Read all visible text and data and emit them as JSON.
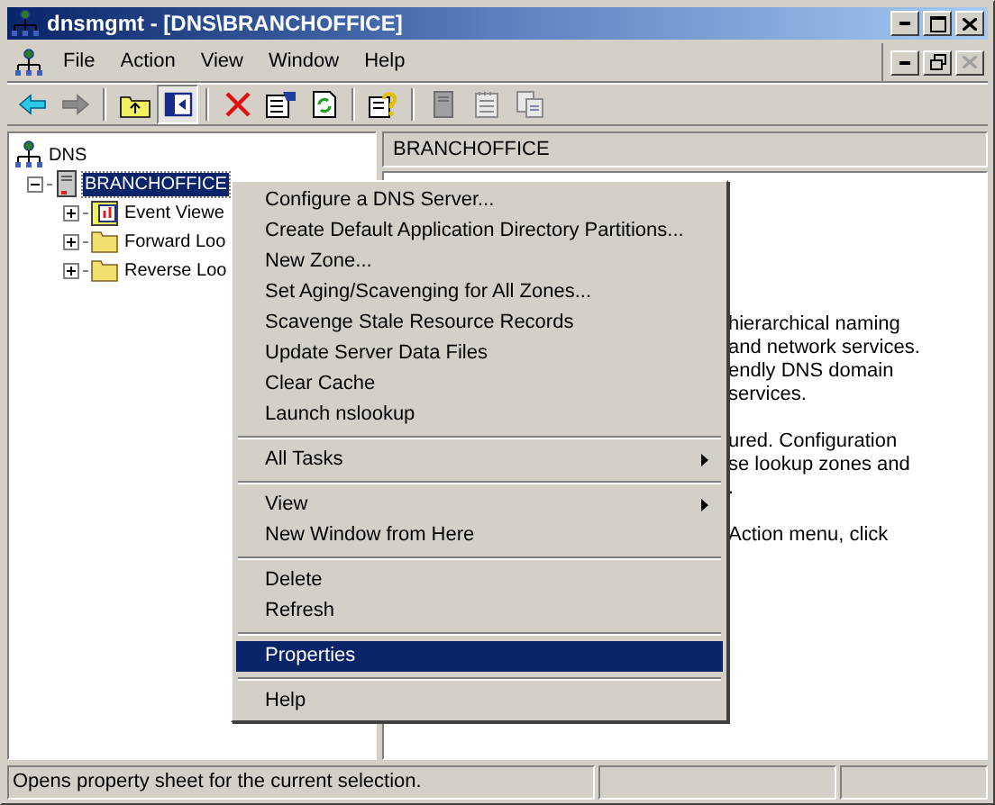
{
  "window": {
    "title": "dnsmgmt - [DNS\\BRANCHOFFICE]"
  },
  "menu_bar": [
    "File",
    "Action",
    "View",
    "Window",
    "Help"
  ],
  "toolbar": [
    {
      "kind": "back",
      "disabled": false,
      "pressed": false
    },
    {
      "kind": "forward",
      "disabled": true,
      "pressed": false
    },
    {
      "kind": "separator"
    },
    {
      "kind": "up",
      "disabled": false,
      "pressed": false
    },
    {
      "kind": "tree",
      "disabled": false,
      "pressed": true
    },
    {
      "kind": "separator"
    },
    {
      "kind": "delete",
      "disabled": false,
      "pressed": false
    },
    {
      "kind": "properties",
      "disabled": false,
      "pressed": false
    },
    {
      "kind": "refresh",
      "disabled": false,
      "pressed": false
    },
    {
      "kind": "separator"
    },
    {
      "kind": "help",
      "disabled": false,
      "pressed": false
    },
    {
      "kind": "separator"
    },
    {
      "kind": "server",
      "disabled": true,
      "pressed": false
    },
    {
      "kind": "notepad",
      "disabled": true,
      "pressed": false
    },
    {
      "kind": "copy",
      "disabled": true,
      "pressed": false
    }
  ],
  "tree": [
    {
      "label": "DNS",
      "kind": "dns",
      "expanded": true,
      "selected": false,
      "children": [
        {
          "label": "BRANCHOFFICE",
          "kind": "server",
          "expanded": true,
          "selected": true,
          "children": [
            {
              "label": "Event Viewe",
              "kind": "events",
              "expanded": false,
              "selected": false
            },
            {
              "label": "Forward Loo",
              "kind": "folder",
              "expanded": false,
              "selected": false
            },
            {
              "label": "Reverse Loo",
              "kind": "folder",
              "expanded": false,
              "selected": false
            }
          ]
        }
      ]
    }
  ],
  "right_pane": {
    "header": "BRANCHOFFICE",
    "paragraphs": [
      [
        "hierarchical naming",
        "and network services.",
        "endly DNS domain",
        "services."
      ],
      [
        "ured. Configuration",
        "se lookup zones and",
        "."
      ],
      [
        "Action menu, click"
      ]
    ]
  },
  "context_menu": [
    {
      "kind": "item",
      "label": "Configure a DNS Server...",
      "submenu": false,
      "selected": false
    },
    {
      "kind": "item",
      "label": "Create Default Application Directory Partitions...",
      "submenu": false,
      "selected": false
    },
    {
      "kind": "item",
      "label": "New Zone...",
      "submenu": false,
      "selected": false
    },
    {
      "kind": "item",
      "label": "Set Aging/Scavenging for All Zones...",
      "submenu": false,
      "selected": false
    },
    {
      "kind": "item",
      "label": "Scavenge Stale Resource Records",
      "submenu": false,
      "selected": false
    },
    {
      "kind": "item",
      "label": "Update Server Data Files",
      "submenu": false,
      "selected": false
    },
    {
      "kind": "item",
      "label": "Clear Cache",
      "submenu": false,
      "selected": false
    },
    {
      "kind": "item",
      "label": "Launch nslookup",
      "submenu": false,
      "selected": false
    },
    {
      "kind": "separator"
    },
    {
      "kind": "item",
      "label": "All Tasks",
      "submenu": true,
      "selected": false
    },
    {
      "kind": "separator"
    },
    {
      "kind": "item",
      "label": "View",
      "submenu": true,
      "selected": false
    },
    {
      "kind": "item",
      "label": "New Window from Here",
      "submenu": false,
      "selected": false
    },
    {
      "kind": "separator"
    },
    {
      "kind": "item",
      "label": "Delete",
      "submenu": false,
      "selected": false
    },
    {
      "kind": "item",
      "label": "Refresh",
      "submenu": false,
      "selected": false
    },
    {
      "kind": "separator"
    },
    {
      "kind": "item",
      "label": "Properties",
      "submenu": false,
      "selected": true
    },
    {
      "kind": "separator"
    },
    {
      "kind": "item",
      "label": "Help",
      "submenu": false,
      "selected": false
    }
  ],
  "status_bar": {
    "text": "Opens property sheet for the current selection."
  }
}
